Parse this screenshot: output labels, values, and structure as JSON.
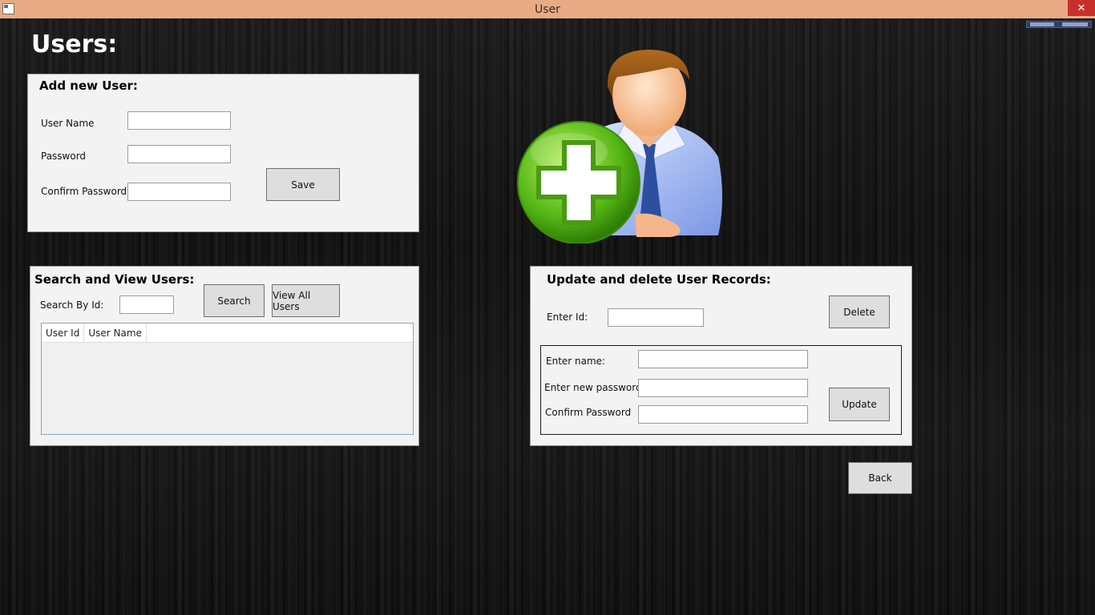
{
  "window": {
    "title": "User"
  },
  "page": {
    "heading": "Users:"
  },
  "add_user": {
    "title": "Add new User:",
    "username_label": "User Name",
    "password_label": "Password",
    "confirm_label": "Confirm Password",
    "username_value": "",
    "password_value": "",
    "confirm_value": "",
    "save_label": "Save"
  },
  "search": {
    "title": "Search and View Users:",
    "search_by_id_label": "Search By Id:",
    "search_value": "",
    "search_label": "Search",
    "view_all_label": "View All Users",
    "columns": [
      "User Id",
      "User Name"
    ]
  },
  "update": {
    "title": "Update and delete User Records:",
    "enter_id_label": "Enter Id:",
    "id_value": "",
    "delete_label": "Delete",
    "name_label": "Enter name:",
    "new_password_label": "Enter new password:",
    "confirm_label": "Confirm Password",
    "name_value": "",
    "new_password_value": "",
    "confirm_value": "",
    "update_label": "Update"
  },
  "nav": {
    "back_label": "Back"
  },
  "colors": {
    "titlebar": "#e8ab86",
    "close_button": "#c7302a",
    "panel_bg": "#f3f3f3",
    "button_bg": "#dedede",
    "plus_green": "#5fbf1a"
  },
  "icons": [
    "app-window-icon",
    "close-icon",
    "add-user-icon"
  ]
}
